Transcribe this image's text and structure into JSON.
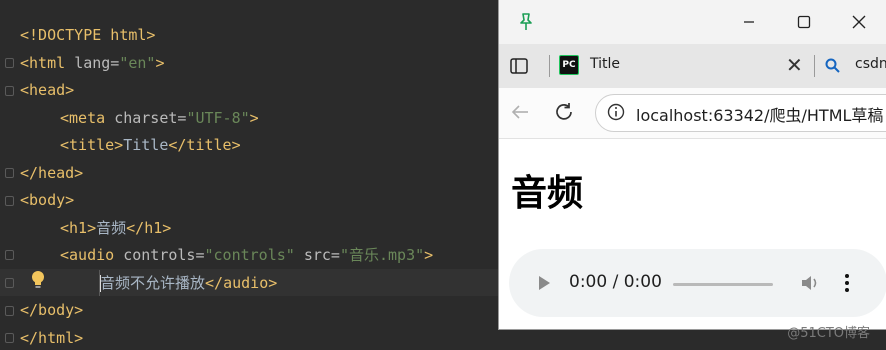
{
  "editor": {
    "lines": [
      {
        "tag_open": "<!DOCTYPE html>"
      },
      {
        "tag_open": "<html ",
        "attr": "lang=",
        "val": "\"en\"",
        "tag_close": ">"
      },
      {
        "tag_open": "<head>"
      },
      {
        "tag_open": "<meta ",
        "attr": "charset=",
        "val": "\"UTF-8\"",
        "tag_close": ">"
      },
      {
        "tag_open": "<title>",
        "text": "Title",
        "tag_close": "</title>"
      },
      {
        "tag_open": "</head>"
      },
      {
        "tag_open": "<body>"
      },
      {
        "tag_open": "<h1>",
        "text": "音频",
        "tag_close": "</h1>"
      },
      {
        "tag_open": "<audio ",
        "attr": "controls=",
        "val": "\"controls\"",
        "attr2": " src=",
        "val2": "\"音乐.mp3\"",
        "tag_close": ">"
      },
      {
        "text": "音频不允许播放",
        "tag_close": "</audio>"
      },
      {
        "tag_open": "</body>"
      },
      {
        "tag_open": "</html>"
      }
    ]
  },
  "browser": {
    "tab_title": "Title",
    "tab2_title": "csdn",
    "address": "localhost:63342/爬虫/HTML草稿",
    "page_heading": "音频",
    "audio_time": "0:00 / 0:00"
  },
  "watermark": "@51CTO博客"
}
